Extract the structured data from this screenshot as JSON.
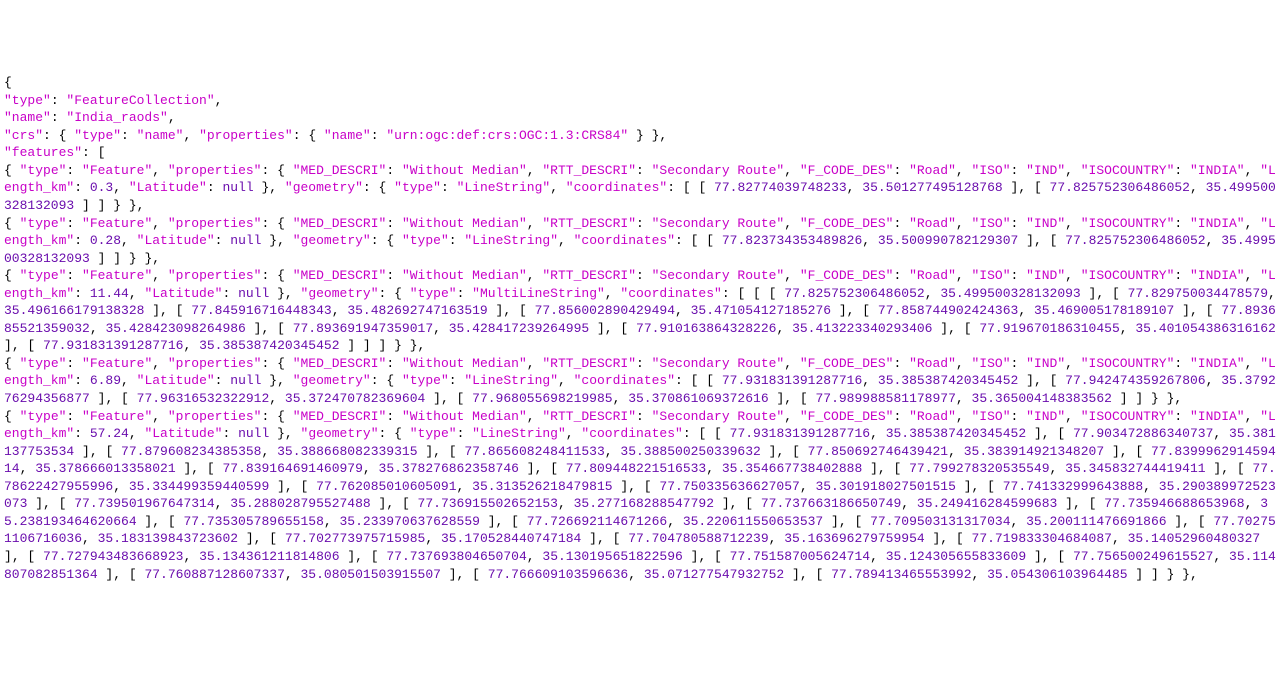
{
  "json": {
    "type": "FeatureCollection",
    "name": "India_raods",
    "crs_type": "name",
    "crs_name": "urn:ogc:def:crs:OGC:1.3:CRS84",
    "features": [
      {
        "MED_DESCRI": "Without Median",
        "RTT_DESCRI": "Secondary Route",
        "F_CODE_DES": "Road",
        "ISO": "IND",
        "ISOCOUNTRY": "INDIA",
        "Length_km": "0.3",
        "Latitude": "null",
        "geom_type": "LineString",
        "coords": [
          [
            "77.82774039748233",
            "35.501277495128768"
          ],
          [
            "77.825752306486052",
            "35.499500328132093"
          ]
        ]
      },
      {
        "MED_DESCRI": "Without Median",
        "RTT_DESCRI": "Secondary Route",
        "F_CODE_DES": "Road",
        "ISO": "IND",
        "ISOCOUNTRY": "INDIA",
        "Length_km": "0.28",
        "Latitude": "null",
        "geom_type": "LineString",
        "coords": [
          [
            "77.823734353489826",
            "35.500990782129307"
          ],
          [
            "77.825752306486052",
            "35.499500328132093"
          ]
        ]
      },
      {
        "MED_DESCRI": "Without Median",
        "RTT_DESCRI": "Secondary Route",
        "F_CODE_DES": "Road",
        "ISO": "IND",
        "ISOCOUNTRY": "INDIA",
        "Length_km": "11.44",
        "Latitude": "null",
        "geom_type": "MultiLineString",
        "coords_multi": [
          [
            [
              "77.825752306486052",
              "35.499500328132093"
            ],
            [
              "77.829750034478579",
              "35.496166179138328"
            ],
            [
              "77.845916716448343",
              "35.482692747163519"
            ],
            [
              "77.856002890429494",
              "35.471054127185276"
            ],
            [
              "77.858744902424363",
              "35.469005178189107"
            ],
            [
              "77.893685521359032",
              "35.428423098264986"
            ],
            [
              "77.893691947359017",
              "35.428417239264995"
            ],
            [
              "77.910163864328226",
              "35.413223340293406"
            ],
            [
              "77.919670186310455",
              "35.401054386316162"
            ],
            [
              "77.931831391287716",
              "35.385387420345452"
            ]
          ]
        ]
      },
      {
        "MED_DESCRI": "Without Median",
        "RTT_DESCRI": "Secondary Route",
        "F_CODE_DES": "Road",
        "ISO": "IND",
        "ISOCOUNTRY": "INDIA",
        "Length_km": "6.89",
        "Latitude": "null",
        "geom_type": "LineString",
        "coords": [
          [
            "77.931831391287716",
            "35.385387420345452"
          ],
          [
            "77.942474359267806",
            "35.379276294356877"
          ],
          [
            "77.96316532322912",
            "35.372470782369604"
          ],
          [
            "77.968055698219985",
            "35.370861069372616"
          ],
          [
            "77.989988581178977",
            "35.365004148383562"
          ]
        ]
      },
      {
        "MED_DESCRI": "Without Median",
        "RTT_DESCRI": "Secondary Route",
        "F_CODE_DES": "Road",
        "ISO": "IND",
        "ISOCOUNTRY": "INDIA",
        "Length_km": "57.24",
        "Latitude": "null",
        "geom_type": "LineString",
        "coords": [
          [
            "77.931831391287716",
            "35.385387420345452"
          ],
          [
            "77.903472886340737",
            "35.381137753534"
          ],
          [
            "77.879608234385358",
            "35.388668082339315"
          ],
          [
            "77.865608248411533",
            "35.388500250339632"
          ],
          [
            "77.850692746439421",
            "35.383914921348207"
          ],
          [
            "77.839996291459414",
            "35.378666013358021"
          ],
          [
            "77.839164691460979",
            "35.378276862358746"
          ],
          [
            "77.809448221516533",
            "35.354667738402888"
          ],
          [
            "77.799278320535549",
            "35.345832744419411"
          ],
          [
            "77.78622427955996",
            "35.334499359440599"
          ],
          [
            "77.762085010605091",
            "35.313526218479815"
          ],
          [
            "77.750335636627057",
            "35.301918027501515"
          ],
          [
            "77.741332999643888",
            "35.290389972523073"
          ],
          [
            "77.739501967647314",
            "35.288028795527488"
          ],
          [
            "77.736915502652153",
            "35.277168288547792"
          ],
          [
            "77.737663186650749",
            "35.249416284599683"
          ],
          [
            "77.735946688653968",
            "35.238193464620664"
          ],
          [
            "77.735305789655158",
            "35.233970637628559"
          ],
          [
            "77.726692114671266",
            "35.220611550653537"
          ],
          [
            "77.709503131317034",
            "35.200111476691866"
          ],
          [
            "77.702751106716036",
            "35.183139843723602"
          ],
          [
            "77.702773975715985",
            "35.170528440747184"
          ],
          [
            "77.704780588712239",
            "35.163696279759954"
          ],
          [
            "77.719833304684087",
            "35.14052960480327"
          ],
          [
            "77.727943483668923",
            "35.134361211814806"
          ],
          [
            "77.737693804650704",
            "35.130195651822596"
          ],
          [
            "77.751587005624714",
            "35.124305655833609"
          ],
          [
            "77.756500249615527",
            "35.114807082851364"
          ],
          [
            "77.760887128607337",
            "35.080501503915507"
          ],
          [
            "77.766609103596636",
            "35.071277547932752"
          ],
          [
            "77.789413465553992",
            "35.054306103964485"
          ]
        ]
      }
    ]
  }
}
